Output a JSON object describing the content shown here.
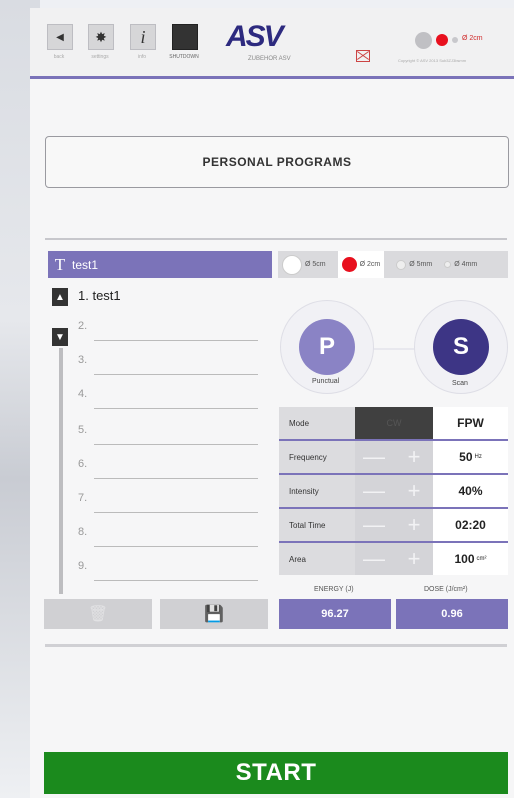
{
  "topbar": {
    "buttons": [
      {
        "icon": "back-icon",
        "glyph": "◀",
        "caption": "back"
      },
      {
        "icon": "gear-icon",
        "glyph": "✸",
        "caption": "settings"
      },
      {
        "icon": "info-icon",
        "glyph": "i",
        "caption": "info"
      },
      {
        "icon": "shutdown-icon",
        "glyph": "",
        "caption": "SHUTDOWN"
      }
    ],
    "logo_text": "ASV",
    "logo_sub": "ZUBEHOR ASV",
    "status_text": "Ø 2cm",
    "status_sub": "Copyright © ASV 2013 Sub3ZJ3bsmm"
  },
  "title_box": "PERSONAL PROGRAMS",
  "programs": {
    "header": "test1",
    "items": [
      "1. test1",
      "2.",
      "3.",
      "4.",
      "5.",
      "6.",
      "7.",
      "8.",
      "9."
    ]
  },
  "sizes": [
    {
      "label": "Ø 5cm",
      "active": false
    },
    {
      "label": "Ø 2cm",
      "active": true
    },
    {
      "label": "Ø 5mm",
      "active": false
    },
    {
      "label": "Ø 4mm",
      "active": false
    }
  ],
  "modes": {
    "p_letter": "P",
    "p_label": "Punctual",
    "s_letter": "S",
    "s_label": "Scan"
  },
  "params": [
    {
      "label": "Mode",
      "value": "FPW",
      "unit": "",
      "ctrl": "CW"
    },
    {
      "label": "Frequency",
      "value": "50",
      "unit": "Hz"
    },
    {
      "label": "Intensity",
      "value": "40%",
      "unit": ""
    },
    {
      "label": "Total Time",
      "value": "02:20",
      "unit": ""
    },
    {
      "label": "Area",
      "value": "100",
      "unit": "cm²"
    }
  ],
  "energy": {
    "label": "ENERGY (J)",
    "value": "96.27"
  },
  "dose": {
    "label": "DOSE (J/cm²)",
    "value": "0.96"
  },
  "start_label": "START",
  "colors": {
    "accent": "#7b73b9",
    "start": "#1b8a1d",
    "active_dot": "#e8101e",
    "mode_s": "#3d3585"
  }
}
